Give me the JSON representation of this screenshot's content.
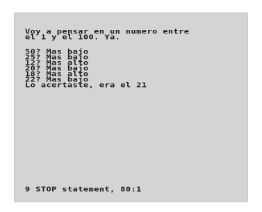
{
  "terminal": {
    "intro_lines": [
      "Voy a pensar en un numero entre",
      "el 1 y el 100. Ya."
    ],
    "guess_lines": [
      "50? Mas bajo",
      "25? Mas bajo",
      "12? Mas alto",
      "20? Mas bajo",
      "18? Mas alto",
      "22? Mas bajo",
      "Lo acertaste, era el 21"
    ],
    "status_line": "9 STOP statement, 80:1"
  },
  "colors": {
    "paper": "#d4d4d4",
    "ink": "#1c1c1c",
    "border": "#ffffff"
  }
}
